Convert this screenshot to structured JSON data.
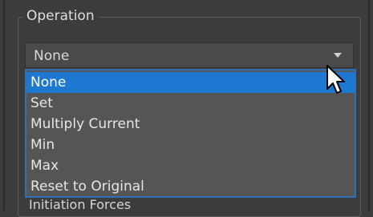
{
  "group": {
    "title": "Operation"
  },
  "combo": {
    "value": "None"
  },
  "dropdown": {
    "items": [
      {
        "label": "None",
        "selected": true
      },
      {
        "label": "Set",
        "selected": false
      },
      {
        "label": "Multiply Current",
        "selected": false
      },
      {
        "label": "Min",
        "selected": false
      },
      {
        "label": "Max",
        "selected": false
      },
      {
        "label": "Reset to Original",
        "selected": false
      }
    ]
  },
  "footer": {
    "label": "Initiation Forces"
  },
  "colors": {
    "selection": "#1e78d2",
    "dropdown_border": "#2f6fb5",
    "panel_bg": "#3c3c3c"
  },
  "icons": {
    "combo_arrow": "chevron-down-icon",
    "cursor": "mouse-pointer-icon"
  }
}
